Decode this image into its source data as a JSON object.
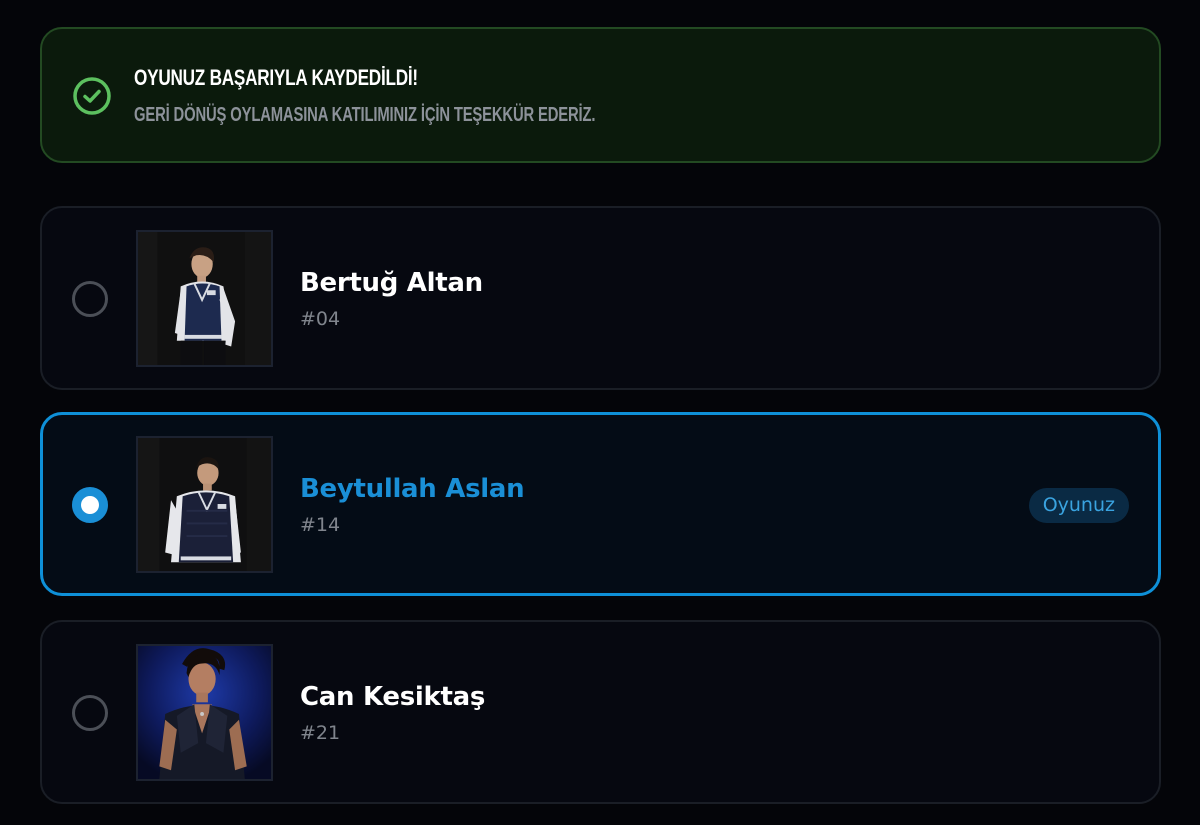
{
  "banner": {
    "icon": "check-circle-icon",
    "title": "OYUNUZ BAŞARIYLA KAYDEDİLDİ!",
    "subtitle": "GERİ DÖNÜŞ OYLAMASINA KATILIMINIZ İÇİN TEŞEKKÜR EDERİZ.",
    "accent_color": "#5cc05f"
  },
  "candidates": [
    {
      "name": "Bertuğ Altan",
      "number": "#04",
      "selected": false
    },
    {
      "name": "Beytullah Aslan",
      "number": "#14",
      "selected": true,
      "badge": "Oyunuz"
    },
    {
      "name": "Can Kesiktaş",
      "number": "#21",
      "selected": false
    }
  ],
  "colors": {
    "background": "#040509",
    "selected_accent": "#1a8fd6",
    "success": "#5cc05f"
  }
}
